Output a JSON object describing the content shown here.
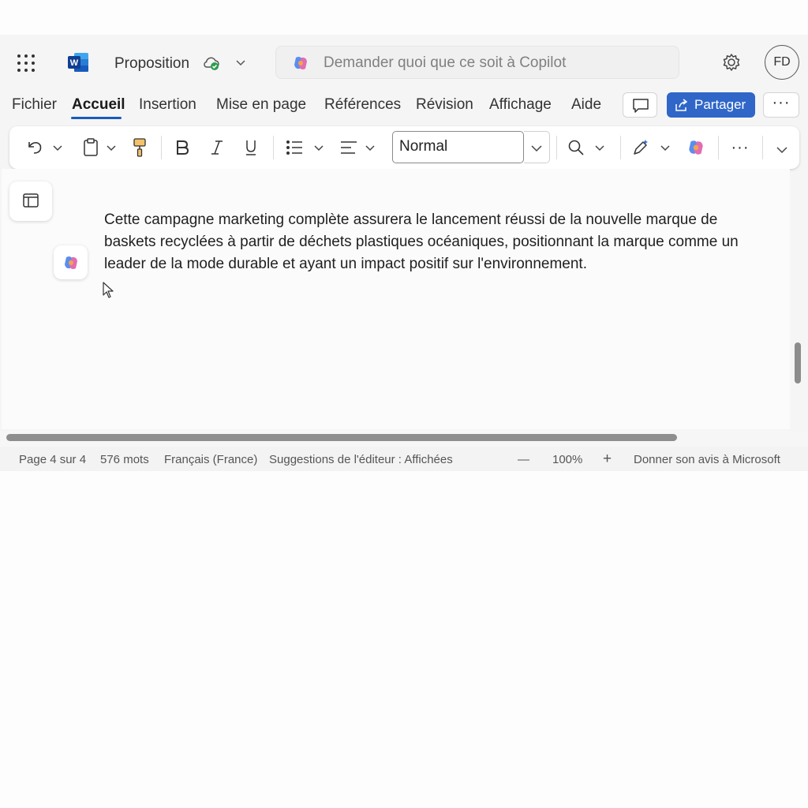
{
  "app": {
    "name": "Word",
    "document_title": "Proposition",
    "copilot_placeholder": "Demander quoi que ce soit à Copilot",
    "user_initials": "FD",
    "accent_color": "#185abd",
    "share_color": "#2f66c8"
  },
  "ribbon": {
    "tabs": [
      {
        "label": "Fichier"
      },
      {
        "label": "Accueil",
        "active": true
      },
      {
        "label": "Insertion"
      },
      {
        "label": "Mise en page"
      },
      {
        "label": "Références"
      },
      {
        "label": "Révision"
      },
      {
        "label": "Affichage"
      },
      {
        "label": "Aide"
      }
    ],
    "share_label": "Partager",
    "more_label": "···"
  },
  "toolbar": {
    "style_value": "Normal",
    "icons": [
      "undo-icon",
      "paste-icon",
      "format-painter-icon",
      "bold-icon",
      "italic-icon",
      "underline-icon",
      "bullets-icon",
      "align-icon",
      "find-icon",
      "editor-icon",
      "copilot-icon",
      "more-icon"
    ],
    "more_label": "···"
  },
  "document": {
    "paragraph": "Cette campagne marketing complète assurera le lancement réussi de la nouvelle marque de baskets recyclées à partir de déchets plastiques océaniques, positionnant la marque comme un leader de la mode durable et ayant un impact positif sur l'environnement."
  },
  "status": {
    "page": "Page 4 sur 4",
    "words": "576 mots",
    "language": "Français (France)",
    "editor": "Suggestions de l'éditeur : Affichées",
    "zoom_out": "—",
    "zoom": "100%",
    "zoom_in": "+",
    "feedback": "Donner son avis à Microsoft"
  }
}
